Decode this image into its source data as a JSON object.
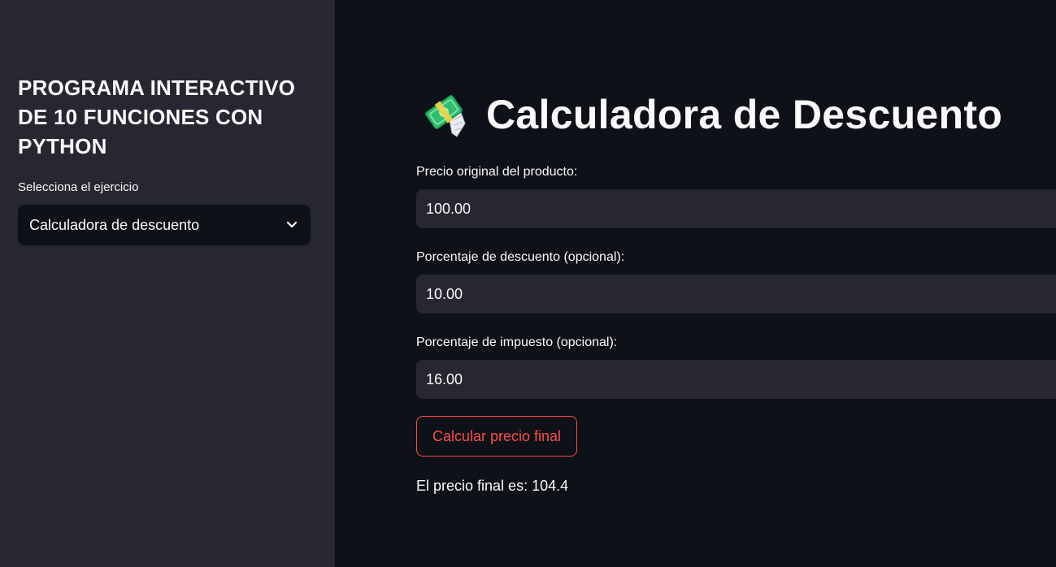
{
  "sidebar": {
    "title": "PROGRAMA INTERACTIVO DE 10 FUNCIONES CON PYTHON",
    "select_label": "Selecciona el ejercicio",
    "select_value": "Calculadora de descuento",
    "select_icon": "chevron-down-icon"
  },
  "main": {
    "title_icon": "money-with-wings-icon",
    "title": "Calculadora de Descuento",
    "fields": [
      {
        "label": "Precio original del producto:",
        "value": "100.00"
      },
      {
        "label": "Porcentaje de descuento (opcional):",
        "value": "10.00"
      },
      {
        "label": "Porcentaje de impuesto (opcional):",
        "value": "16.00"
      }
    ],
    "button_label": "Calcular precio final",
    "result_text": "El precio final es: 104.4"
  },
  "colors": {
    "background": "#0e1117",
    "sidebar": "#262730",
    "input": "#262730",
    "accent": "#ff4b4b",
    "text": "#fafafa"
  }
}
